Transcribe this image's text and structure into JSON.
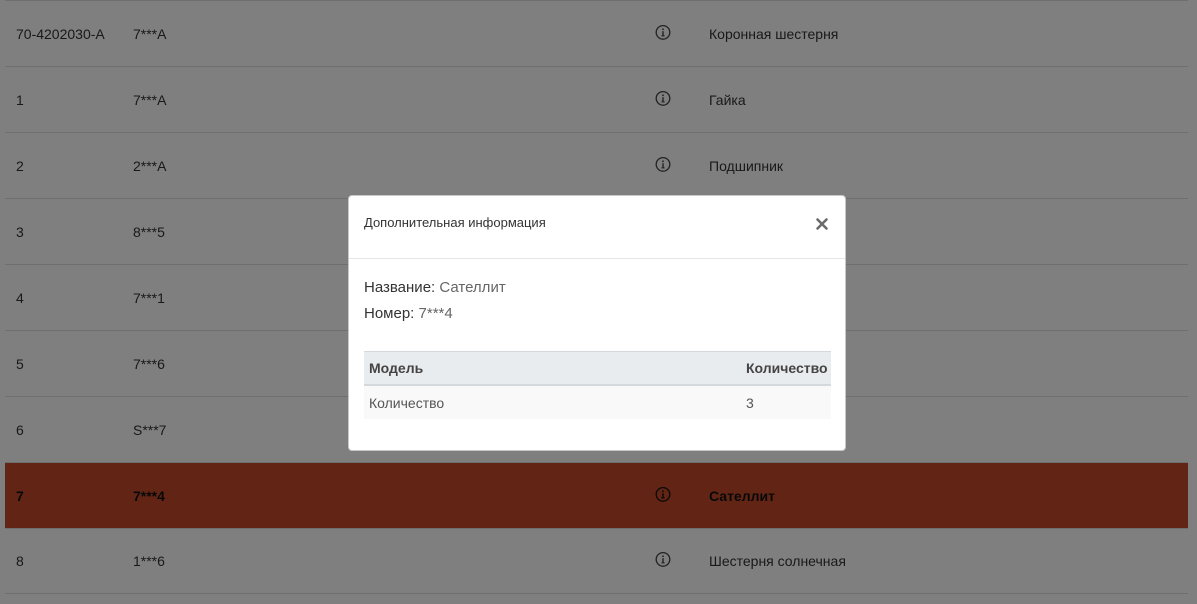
{
  "parts": {
    "rows": [
      {
        "pos": "70-4202030-A",
        "number": "7***A",
        "name": "Коронная шестерня",
        "selected": false
      },
      {
        "pos": "1",
        "number": "7***A",
        "name": "Гайка",
        "selected": false
      },
      {
        "pos": "2",
        "number": "2***A",
        "name": "Подшипник",
        "selected": false
      },
      {
        "pos": "3",
        "number": "8***5",
        "name": "",
        "selected": false
      },
      {
        "pos": "4",
        "number": "7***1",
        "name": "",
        "selected": false
      },
      {
        "pos": "5",
        "number": "7***6",
        "name": "",
        "selected": false
      },
      {
        "pos": "6",
        "number": "S***7",
        "name": "",
        "selected": false
      },
      {
        "pos": "7",
        "number": "7***4",
        "name": "Сателлит",
        "selected": true
      },
      {
        "pos": "8",
        "number": "1***6",
        "name": "Шестерня солнечная",
        "selected": false
      }
    ]
  },
  "modal": {
    "title": "Дополнительная информация",
    "close_icon": "close-icon",
    "name_label": "Название:",
    "name_value": "Сателлит",
    "number_label": "Номер:",
    "number_value": "7***4",
    "table": {
      "headers": [
        "Модель",
        "Количество"
      ],
      "rows": [
        [
          "Количество",
          "3"
        ]
      ]
    }
  },
  "colors": {
    "selected_row": "#c44a2a",
    "backdrop": "rgba(0,0,0,0.5)",
    "table_head": "#e9ecef"
  }
}
